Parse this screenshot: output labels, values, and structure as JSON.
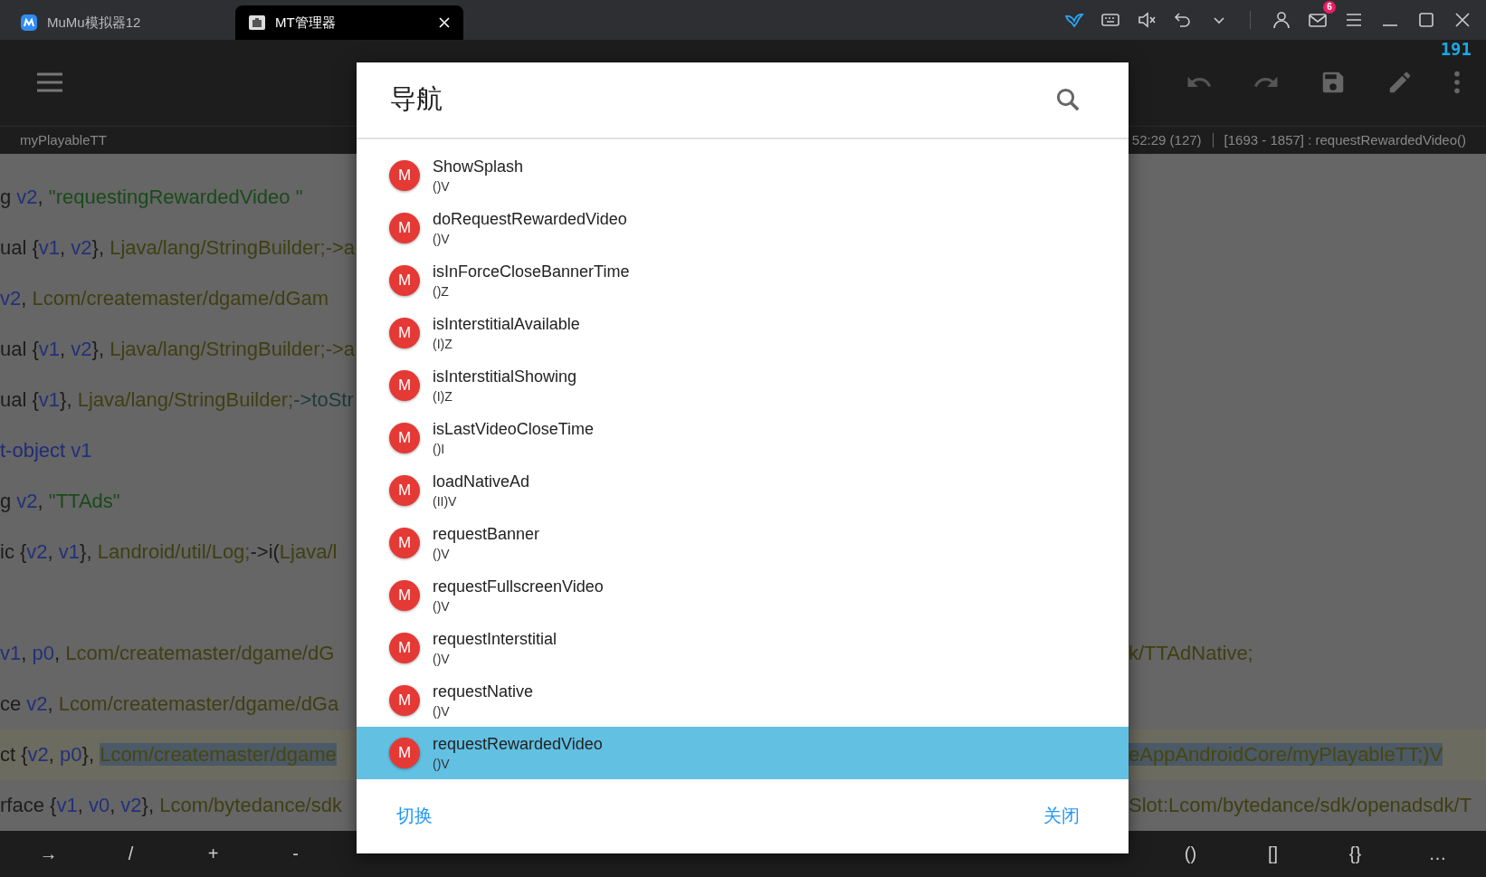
{
  "tabs": [
    {
      "label": "MuMu模拟器12",
      "selected": false
    },
    {
      "label": "MT管理器",
      "selected": true
    }
  ],
  "mail_badge": "6",
  "toolbar": {
    "counter": "191"
  },
  "info_bar": {
    "file": "myPlayableTT",
    "position": "52:29 (127)",
    "range": "[1693 - 1857] : requestRewardedVideo()"
  },
  "code_lines": [
    {
      "kind": "code",
      "left": [
        {
          "kind": "kw",
          "text": "g "
        },
        {
          "kind": "reg",
          "text": "v2"
        },
        {
          "kind": "punct",
          "text": ", "
        },
        {
          "kind": "str",
          "text": "\"requestingRewardedVideo \""
        }
      ]
    },
    {
      "kind": "code",
      "left": [
        {
          "kind": "kw",
          "text": "ual "
        },
        {
          "kind": "punct",
          "text": "{"
        },
        {
          "kind": "reg",
          "text": "v1"
        },
        {
          "kind": "punct",
          "text": ", "
        },
        {
          "kind": "reg",
          "text": "v2"
        },
        {
          "kind": "punct",
          "text": "}, "
        },
        {
          "kind": "type",
          "text": "Ljava/lang/StringBuilder;->a"
        }
      ]
    },
    {
      "kind": "code",
      "left": [
        {
          "kind": "reg",
          "text": "v2"
        },
        {
          "kind": "punct",
          "text": ", "
        },
        {
          "kind": "type",
          "text": "Lcom/createmaster/dgame/dGam"
        }
      ]
    },
    {
      "kind": "code",
      "left": [
        {
          "kind": "kw",
          "text": "ual "
        },
        {
          "kind": "punct",
          "text": "{"
        },
        {
          "kind": "reg",
          "text": "v1"
        },
        {
          "kind": "punct",
          "text": ", "
        },
        {
          "kind": "reg",
          "text": "v2"
        },
        {
          "kind": "punct",
          "text": "}, "
        },
        {
          "kind": "type",
          "text": "Ljava/lang/StringBuilder;->a"
        }
      ]
    },
    {
      "kind": "code",
      "left": [
        {
          "kind": "kw",
          "text": "ual "
        },
        {
          "kind": "punct",
          "text": "{"
        },
        {
          "kind": "reg",
          "text": "v1"
        },
        {
          "kind": "punct",
          "text": "}, "
        },
        {
          "kind": "type",
          "text": "Ljava/lang/StringBuilder;"
        },
        {
          "kind": "method",
          "text": "->toStr"
        }
      ]
    },
    {
      "kind": "code",
      "left": [
        {
          "kind": "opcode",
          "text": "t-object "
        },
        {
          "kind": "reg",
          "text": "v1"
        }
      ]
    },
    {
      "kind": "code",
      "left": [
        {
          "kind": "kw",
          "text": "g "
        },
        {
          "kind": "reg",
          "text": "v2"
        },
        {
          "kind": "punct",
          "text": ", "
        },
        {
          "kind": "str",
          "text": "\"TTAds\""
        }
      ]
    },
    {
      "kind": "code",
      "left": [
        {
          "kind": "kw",
          "text": "ic "
        },
        {
          "kind": "punct",
          "text": "{"
        },
        {
          "kind": "reg",
          "text": "v2"
        },
        {
          "kind": "punct",
          "text": ", "
        },
        {
          "kind": "reg",
          "text": "v1"
        },
        {
          "kind": "punct",
          "text": "}, "
        },
        {
          "kind": "type",
          "text": "Landroid/util/Log;"
        },
        {
          "kind": "punct",
          "text": "->i("
        },
        {
          "kind": "type",
          "text": "Ljava/l"
        }
      ]
    },
    {
      "kind": "blank"
    },
    {
      "kind": "code",
      "left": [
        {
          "kind": "reg",
          "text": "v1"
        },
        {
          "kind": "punct",
          "text": ", "
        },
        {
          "kind": "reg",
          "text": "p0"
        },
        {
          "kind": "punct",
          "text": ", "
        },
        {
          "kind": "type",
          "text": "Lcom/createmaster/dgame/dG"
        }
      ],
      "right": [
        {
          "kind": "type",
          "text": "k/TTAdNative;"
        }
      ]
    },
    {
      "kind": "code",
      "left": [
        {
          "kind": "kw",
          "text": "ce "
        },
        {
          "kind": "reg",
          "text": "v2"
        },
        {
          "kind": "punct",
          "text": ", "
        },
        {
          "kind": "type",
          "text": "Lcom/createmaster/dgame/dGa"
        }
      ]
    },
    {
      "kind": "current",
      "left": [
        {
          "kind": "kw",
          "text": "ct "
        },
        {
          "kind": "punct",
          "text": "{"
        },
        {
          "kind": "reg",
          "text": "v2"
        },
        {
          "kind": "punct",
          "text": ", "
        },
        {
          "kind": "reg",
          "text": "p0"
        },
        {
          "kind": "punct",
          "text": "}, "
        },
        {
          "kind": "selection",
          "text": "Lcom/createmaster/dgame"
        }
      ],
      "right": [
        {
          "kind": "selection",
          "text": "eAppAndroidCore/myPlayableTT;)V"
        }
      ]
    },
    {
      "kind": "code",
      "left": [
        {
          "kind": "kw",
          "text": "rface "
        },
        {
          "kind": "punct",
          "text": "{"
        },
        {
          "kind": "reg",
          "text": "v1"
        },
        {
          "kind": "punct",
          "text": ", "
        },
        {
          "kind": "reg",
          "text": "v0"
        },
        {
          "kind": "punct",
          "text": ", "
        },
        {
          "kind": "reg",
          "text": "v2"
        },
        {
          "kind": "punct",
          "text": "}, "
        },
        {
          "kind": "type",
          "text": "Lcom/bytedance/sdk"
        }
      ],
      "right": [
        {
          "kind": "type",
          "text": "Slot:Lcom/bytedance/sdk/openadsdk/T"
        }
      ]
    }
  ],
  "dialog": {
    "title": "导航",
    "items": [
      {
        "badge": "M",
        "name": "ShowSplash",
        "signature": "()V",
        "selected": false
      },
      {
        "badge": "M",
        "name": "doRequestRewardedVideo",
        "signature": "()V",
        "selected": false
      },
      {
        "badge": "M",
        "name": "isInForceCloseBannerTime",
        "signature": "()Z",
        "selected": false
      },
      {
        "badge": "M",
        "name": "isInterstitialAvailable",
        "signature": "(I)Z",
        "selected": false
      },
      {
        "badge": "M",
        "name": "isInterstitialShowing",
        "signature": "(I)Z",
        "selected": false
      },
      {
        "badge": "M",
        "name": "isLastVideoCloseTime",
        "signature": "()I",
        "selected": false
      },
      {
        "badge": "M",
        "name": "loadNativeAd",
        "signature": "(II)V",
        "selected": false
      },
      {
        "badge": "M",
        "name": "requestBanner",
        "signature": "()V",
        "selected": false
      },
      {
        "badge": "M",
        "name": "requestFullscreenVideo",
        "signature": "()V",
        "selected": false
      },
      {
        "badge": "M",
        "name": "requestInterstitial",
        "signature": "()V",
        "selected": false
      },
      {
        "badge": "M",
        "name": "requestNative",
        "signature": "()V",
        "selected": false
      },
      {
        "badge": "M",
        "name": "requestRewardedVideo",
        "signature": "()V",
        "selected": true
      }
    ],
    "buttons": [
      "切换",
      "关闭"
    ]
  },
  "keys": {
    "left": [
      "→",
      "/",
      "+",
      "-"
    ],
    "right": [
      "()",
      "[]",
      "{}",
      "…"
    ]
  }
}
